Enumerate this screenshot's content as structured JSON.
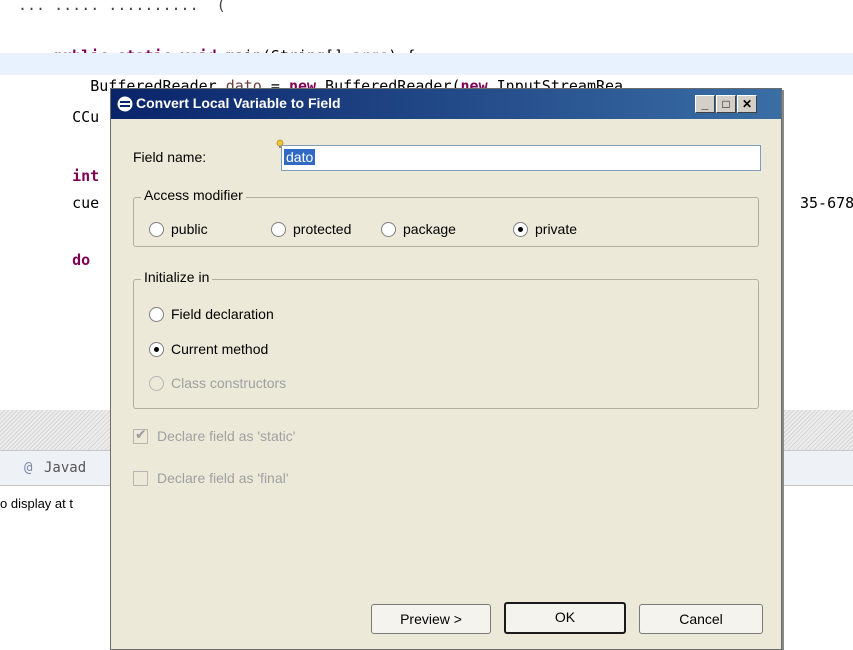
{
  "editor": {
    "line0": "... ..... ..........  (",
    "line1_kw1": "public static void",
    "line1_rest": " main(String[] ",
    "line1_param": "args",
    "line1_end": ") {",
    "line2_pre": "    BufferedReader ",
    "line2_var": "dato",
    "line2_mid": " = ",
    "line2_new1": "new",
    "line2_mid2": " BufferedReader(",
    "line2_new2": "new",
    "line2_end": " InputStreamRea",
    "line3": "    CCu",
    "line4": "    int",
    "line5": "    cue",
    "line5_right": "35-678",
    "line6": "    do"
  },
  "javadoc": {
    "at": "@",
    "label": "Javad",
    "text": "o display at t"
  },
  "dialog": {
    "title": "Convert Local Variable to Field",
    "field_name_label": "Field name:",
    "field_name_value": "dato",
    "access_group": "Access modifier",
    "access_options": [
      "public",
      "protected",
      "package",
      "private"
    ],
    "access_selected": "private",
    "init_group": "Initialize in",
    "init_options": [
      "Field declaration",
      "Current method",
      "Class constructors"
    ],
    "init_selected": "Current method",
    "static_label": "Declare field as 'static'",
    "final_label": "Declare field as 'final'",
    "buttons": {
      "preview": "Preview >",
      "ok": "OK",
      "cancel": "Cancel"
    },
    "titlebar_buttons": {
      "minimize": "_",
      "maximize": "□",
      "close": "✕"
    }
  },
  "icons": {
    "dialog_icon": "refactor-icon",
    "bulb": "lightbulb-icon"
  },
  "colors": {
    "keyword": "#7f0055",
    "title_bar": "#0a246a",
    "selection": "#316ac5"
  }
}
